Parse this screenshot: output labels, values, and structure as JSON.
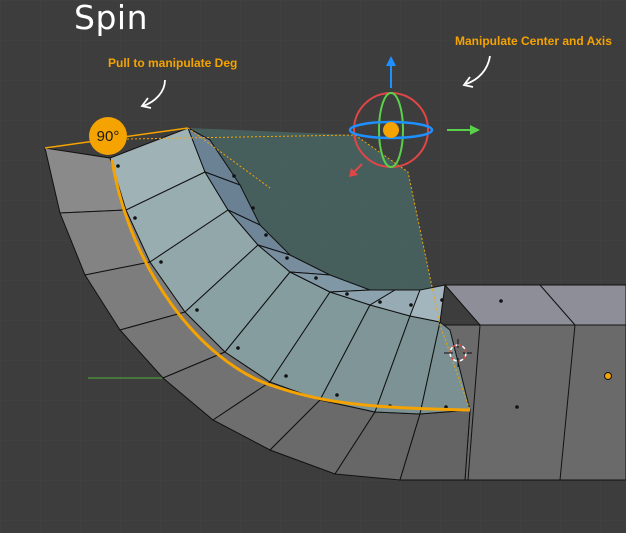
{
  "viewport": {
    "title": "Spin",
    "annotations": {
      "pull_deg": "Pull to manipulate Deg",
      "center_axis": "Manipulate Center and Axis"
    },
    "angle_badge": "90°"
  },
  "colors": {
    "background": "#3d3d3d",
    "accent": "#f5a300",
    "mesh_face": "#7d7d7d",
    "selected_face": "#8aa3a6",
    "arrow_z": "#1e90ff",
    "arrow_x_red": "#e04646",
    "arrow_y_green": "#59d14a"
  },
  "icons": [
    "arrow-up-icon",
    "arrow-right-icon",
    "arrow-down-left-icon",
    "gizmo-sphere-icon",
    "3d-cursor-icon"
  ]
}
